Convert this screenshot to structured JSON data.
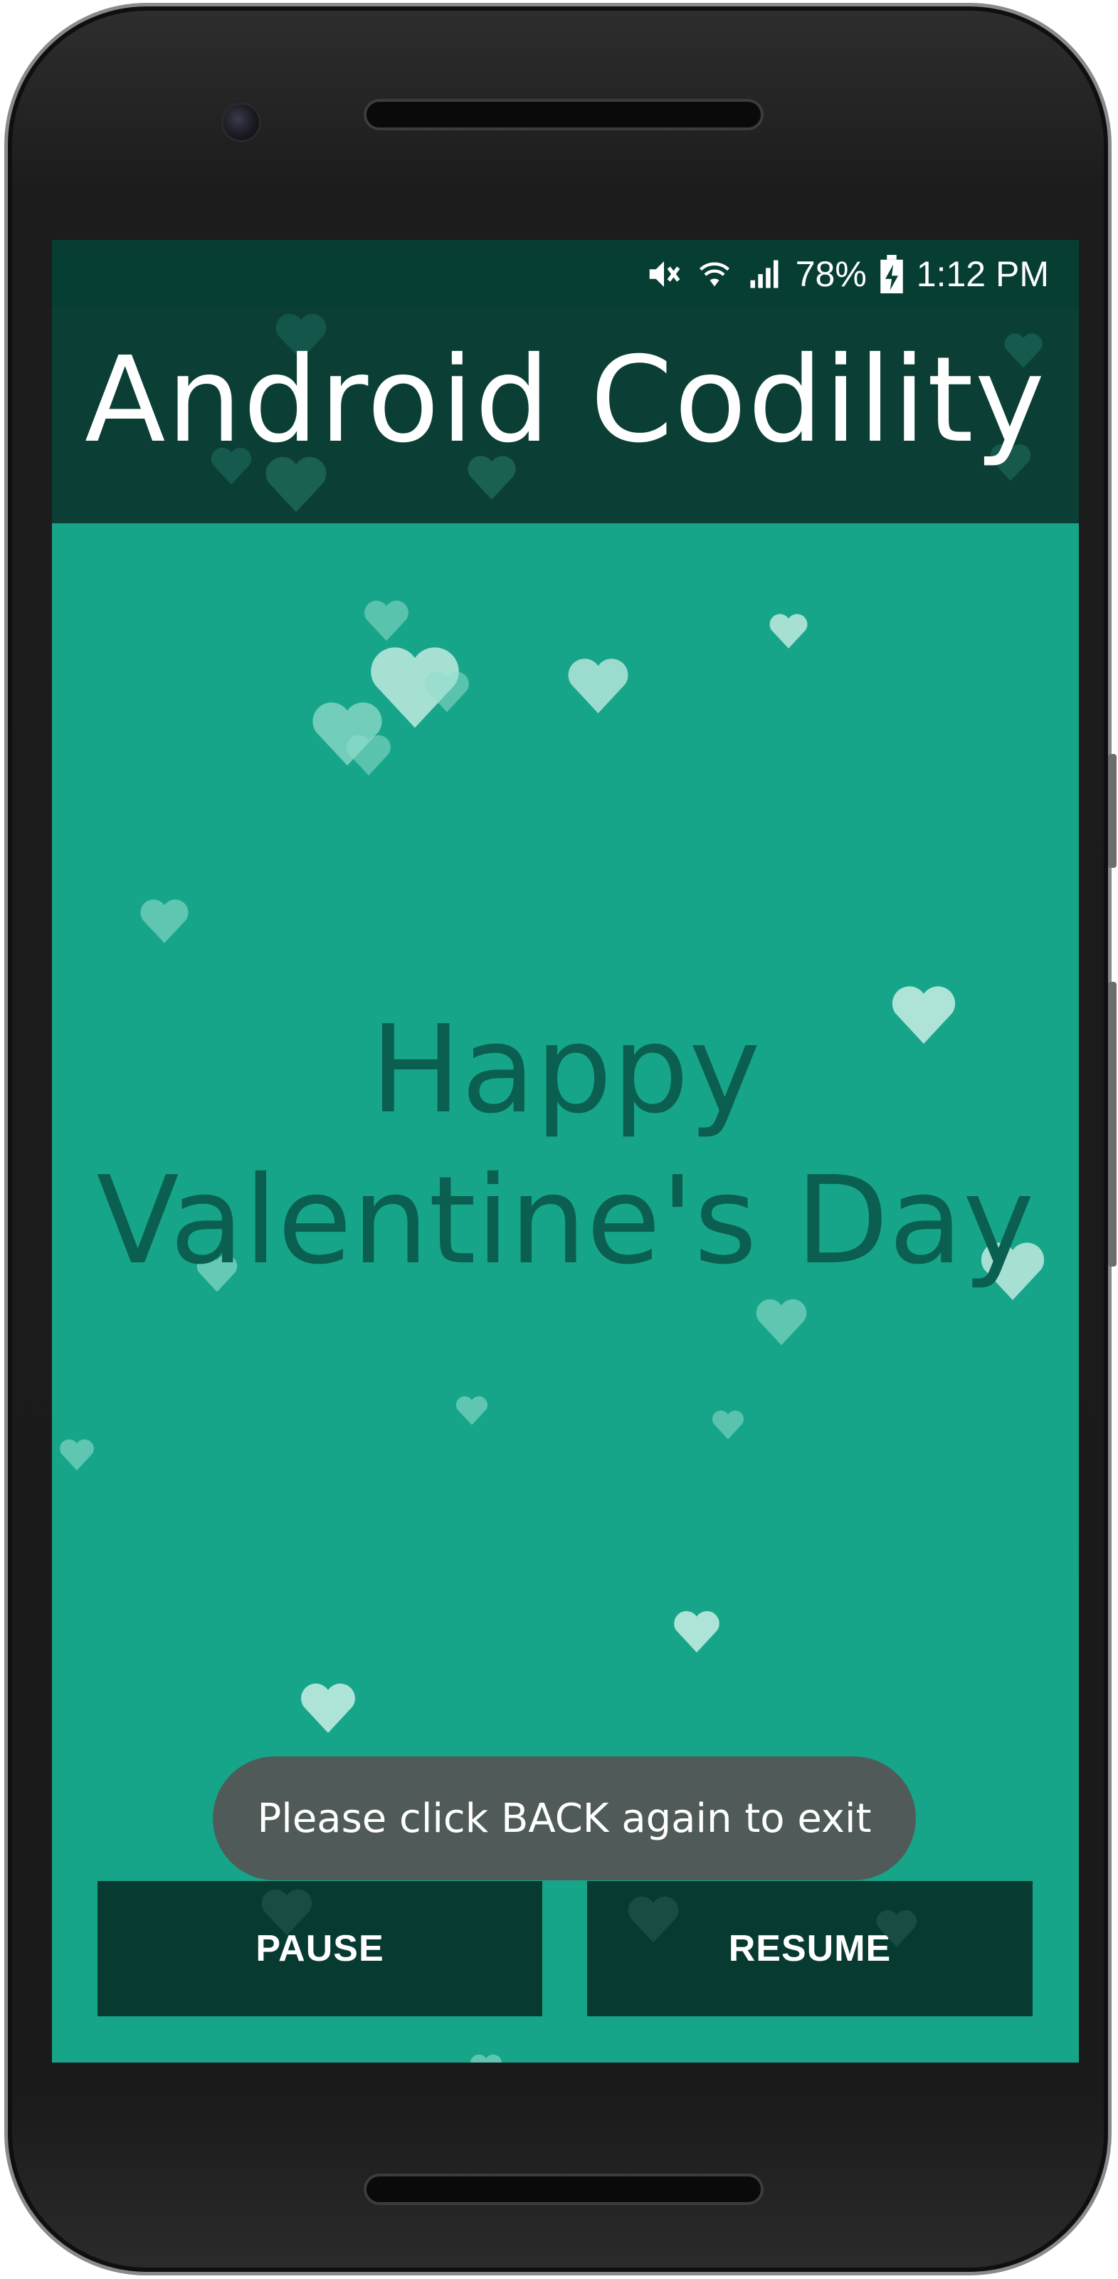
{
  "status_bar": {
    "battery_percent": "78%",
    "time": "1:12 PM",
    "icons": [
      "mute-icon",
      "wifi-icon",
      "signal-icon",
      "battery-charging-icon"
    ]
  },
  "app_bar": {
    "title": "Android Codility"
  },
  "main": {
    "greeting": "Happy Valentine's Day",
    "decoration": "floating-hearts"
  },
  "buttons": {
    "pause_label": "PAUSE",
    "resume_label": "RESUME"
  },
  "toast": {
    "message": "Please click BACK again to exit"
  },
  "colors": {
    "screen_background": "#17a589",
    "app_bar": "#0b3f36",
    "status_bar": "#073e34",
    "button_background": "#073a31",
    "greeting_text": "#0b5f50",
    "toast_background": "#555555"
  }
}
